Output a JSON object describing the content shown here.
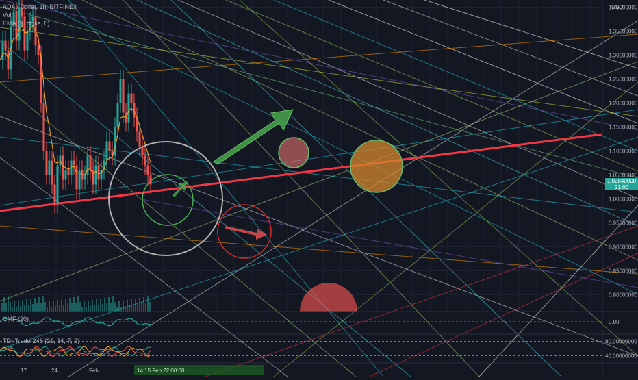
{
  "legend": {
    "symbol": "ADA / Dollar, 1h, BITFINEX",
    "vol": "Vol",
    "ema": "EMA (9, close, 0)"
  },
  "currency": "USD",
  "colors": {
    "background": "#131722",
    "accent_line": "#f23645",
    "up": "#26a69a",
    "down": "#ef5350",
    "axis_text": "#b2b5be"
  },
  "chart_data": [
    {
      "type": "line",
      "title": "ADA / Dollar, 1h, BITFINEX",
      "y_ticks": [
        "1.40000000",
        "1.35000000",
        "1.30000000",
        "1.25000000",
        "1.20000000",
        "1.15000000",
        "1.10000000",
        "1.05000000",
        "1.00000000",
        "0.95000000",
        "0.90000000",
        "0.85000000",
        "0.80000000"
      ],
      "ylim": [
        0.765,
        1.415
      ],
      "x_ticks": [
        "17",
        "24",
        "Feb"
      ],
      "last_price": {
        "value": "1.02840000",
        "countdown": "21:00"
      },
      "price_series": {
        "name": "ADA/USD",
        "x": [
          0,
          4,
          8,
          12,
          16,
          20,
          24,
          28,
          32,
          36,
          40,
          44,
          48,
          52,
          56,
          60,
          64,
          68,
          72,
          76,
          80,
          84,
          88,
          92,
          96,
          100,
          104,
          108,
          112,
          116,
          120,
          124,
          128,
          132,
          136,
          140,
          144,
          148,
          152,
          156,
          160,
          164,
          168,
          172,
          176,
          180,
          184,
          188,
          192,
          196,
          200,
          204,
          208,
          212,
          216,
          220
        ],
        "values": [
          1.29,
          1.33,
          1.31,
          1.27,
          1.36,
          1.39,
          1.33,
          1.4,
          1.38,
          1.31,
          1.35,
          1.37,
          1.38,
          1.32,
          1.3,
          1.2,
          1.1,
          1.05,
          1.08,
          1.03,
          0.99,
          1.07,
          1.09,
          1.04,
          1.06,
          1.05,
          1.08,
          1.07,
          1.02,
          1.06,
          1.04,
          1.05,
          1.09,
          1.06,
          1.03,
          1.07,
          1.04,
          1.06,
          1.08,
          1.12,
          1.1,
          1.09,
          1.15,
          1.2,
          1.25,
          1.18,
          1.16,
          1.22,
          1.2,
          1.17,
          1.14,
          1.11,
          1.09,
          1.07,
          1.05,
          1.03
        ]
      },
      "trendline": {
        "start": 0.975,
        "end": 1.135
      },
      "grid": true
    },
    {
      "type": "line",
      "title": "CMF (20)",
      "y_ticks": [
        "0.00"
      ],
      "ylim": [
        -0.4,
        0.4
      ]
    },
    {
      "type": "line",
      "title": "TDI-Trader248 (21, 34, 7, 2)",
      "y_ticks": [
        "80.00000000",
        "40.00000000"
      ],
      "ylim": [
        20,
        100
      ]
    }
  ],
  "bottom_labels": "14:15 Feb 22 00:00"
}
